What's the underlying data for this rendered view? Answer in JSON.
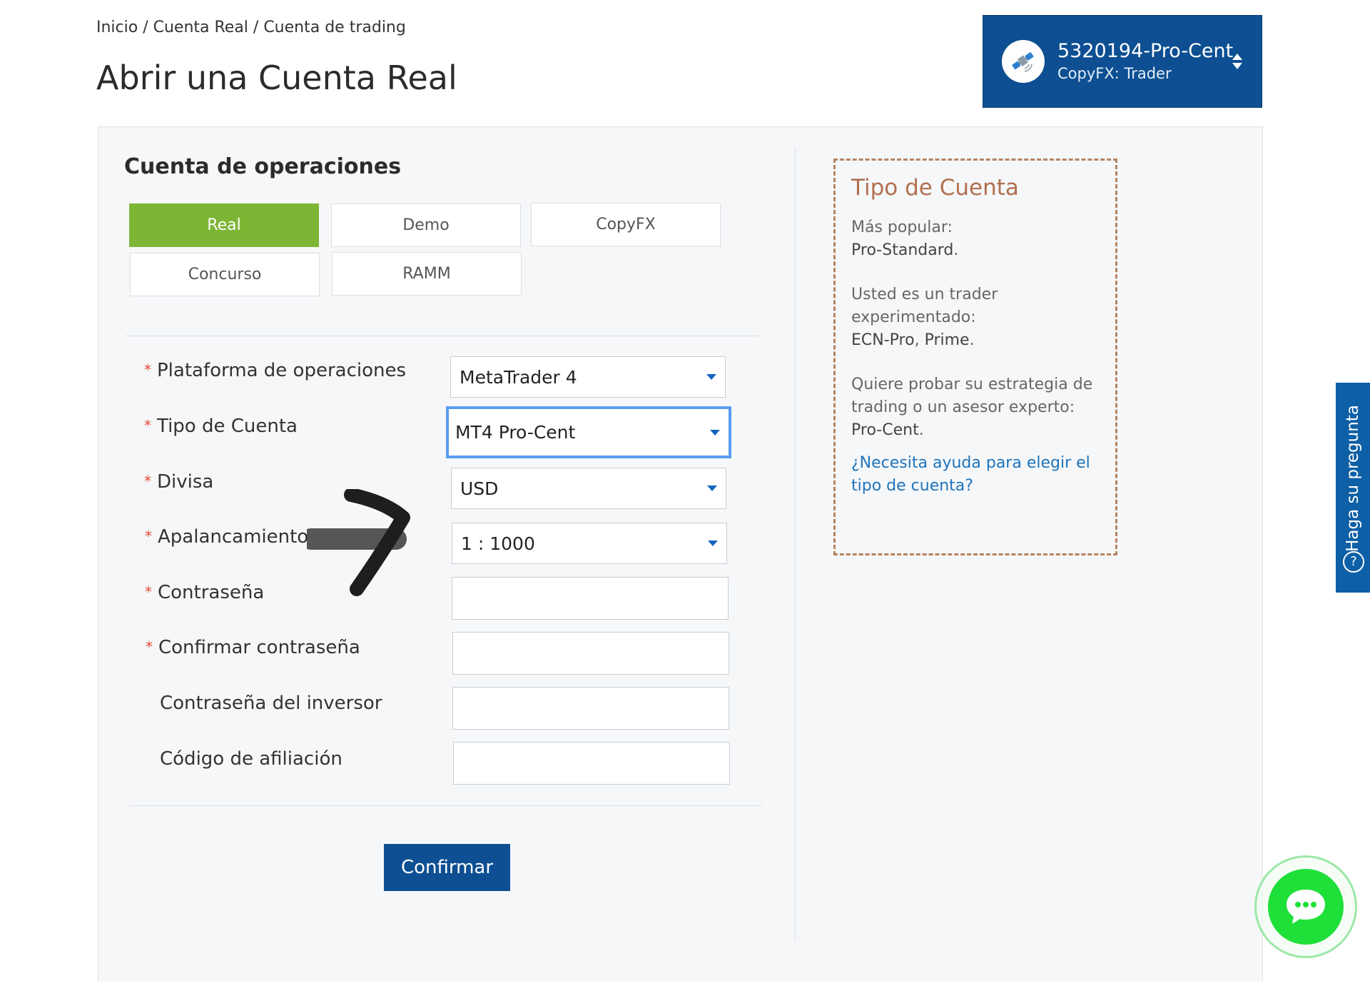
{
  "breadcrumb": {
    "text": "Inicio / Cuenta Real / Cuenta de trading"
  },
  "page": {
    "title": "Abrir una Cuenta Real"
  },
  "account_switcher": {
    "number": "5320194-Pro-Cent",
    "type": "CopyFX: Trader",
    "avatar_icon": "satellite-icon",
    "toggle_icon": "sort-arrows-icon"
  },
  "section": {
    "title": "Cuenta de operaciones"
  },
  "tabs": [
    {
      "label": "Real",
      "active": true
    },
    {
      "label": "Demo",
      "active": false
    },
    {
      "label": "CopyFX",
      "active": false
    },
    {
      "label": "Concurso",
      "active": false
    },
    {
      "label": "RAMM",
      "active": false
    }
  ],
  "form": {
    "required_mark": "*",
    "fields": [
      {
        "label": "Plataforma de operaciones",
        "required": true,
        "type": "select",
        "value": "MetaTrader 4"
      },
      {
        "label": "Tipo de Cuenta",
        "required": true,
        "type": "select",
        "value": "MT4 Pro-Cent",
        "focused": true
      },
      {
        "label": "Divisa",
        "required": true,
        "type": "select",
        "value": "USD"
      },
      {
        "label": "Apalancamiento",
        "required": true,
        "type": "select",
        "value": "1 : 1000"
      },
      {
        "label": "Contraseña",
        "required": true,
        "type": "password",
        "value": ""
      },
      {
        "label": "Confirmar contraseña",
        "required": true,
        "type": "password",
        "value": ""
      },
      {
        "label": "Contraseña del inversor",
        "required": false,
        "type": "password",
        "value": ""
      },
      {
        "label": "Código de afiliación",
        "required": false,
        "type": "text",
        "value": ""
      }
    ],
    "submit_label": "Confirmar"
  },
  "info_box": {
    "title": "Tipo de Cuenta",
    "p1_text": "Más popular:",
    "p1_bold": "Pro-Standard",
    "p2_text": "Usted es un trader experimentado:",
    "p2_bold_1": "ECN-Pro",
    "p2_bold_2": "Prime",
    "p3_text": "Quiere probar su estrategia de trading o un asesor experto:",
    "p3_bold": "Pro-Cent",
    "link": "¿Necesita ayuda para elegir el tipo de cuenta?"
  },
  "help_tab": {
    "label": "Haga su pregunta",
    "icon": "question-circle-icon"
  },
  "chat": {
    "icon": "chat-bubble-icon"
  },
  "colors": {
    "brand_blue": "#0d4f92",
    "active_tab_green": "#7db535",
    "required_red": "#e04b35",
    "focus_blue": "#5a9cf0",
    "info_border": "#b7835f",
    "info_title": "#b26f4d",
    "link_blue": "#1f74bb",
    "chat_green": "#1ee038"
  }
}
